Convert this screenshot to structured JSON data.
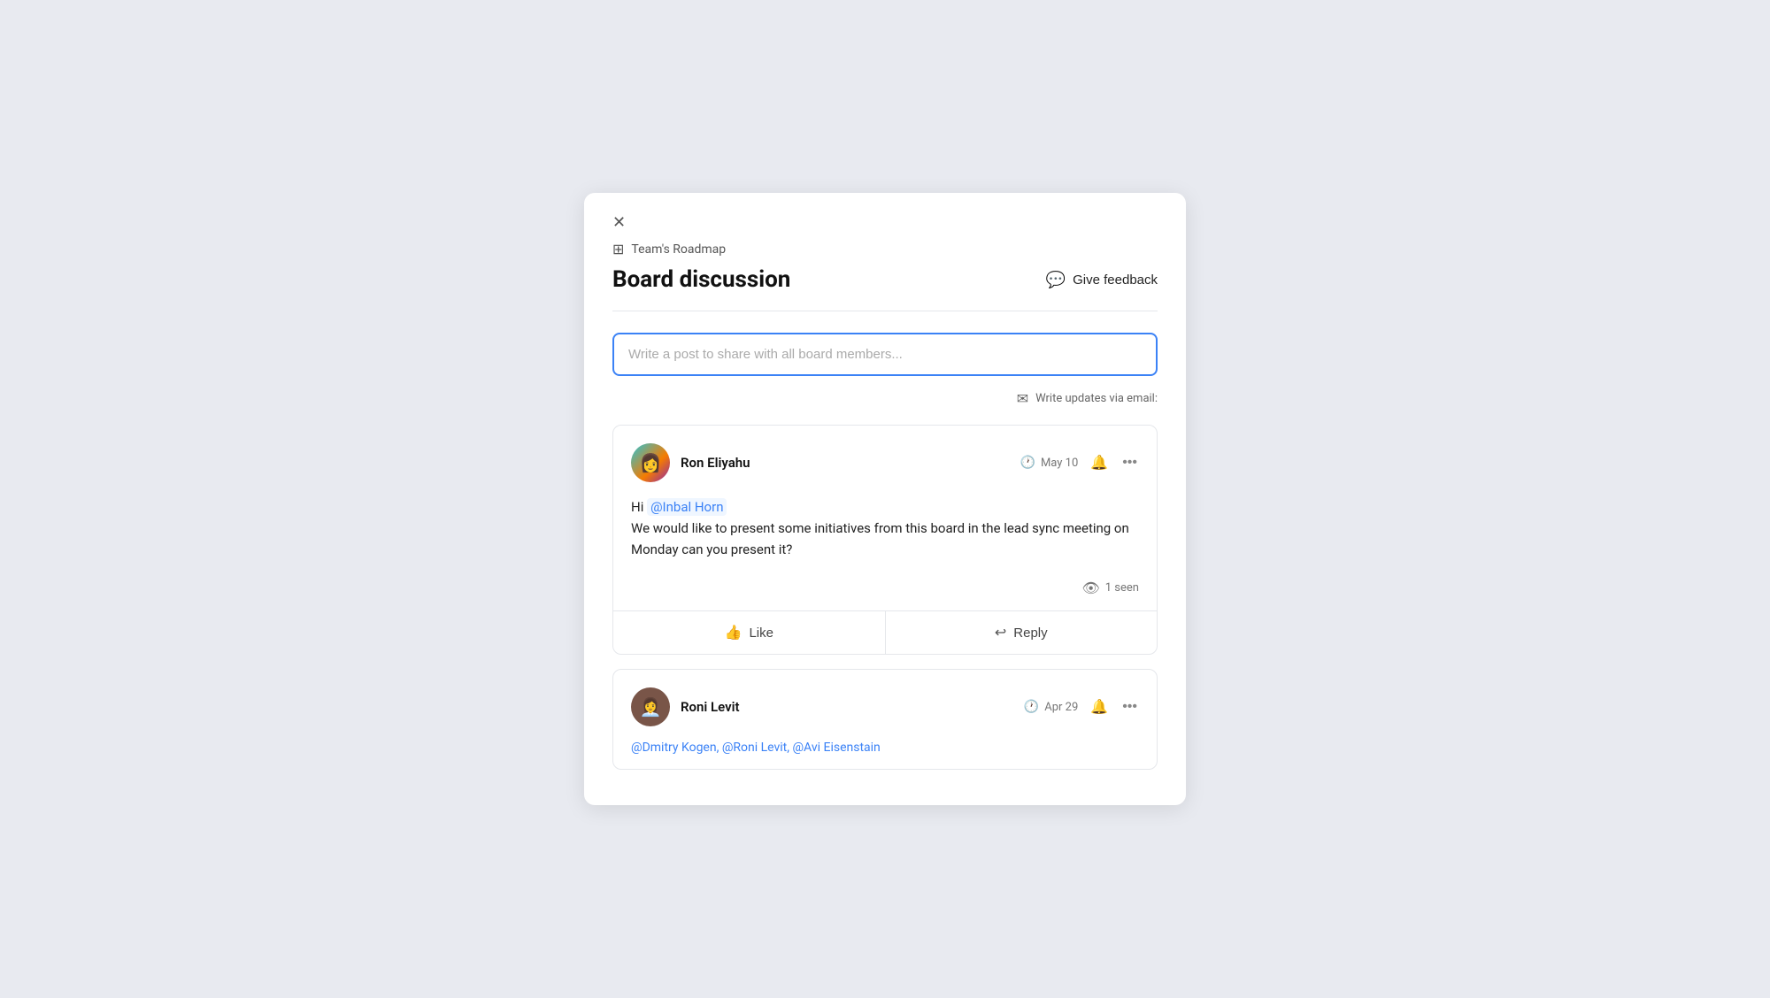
{
  "modal": {
    "close_label": "×",
    "breadcrumb": {
      "icon": "⊞",
      "text": "Team's Roadmap"
    },
    "title": "Board discussion",
    "give_feedback_label": "Give feedback",
    "post_input_placeholder": "Write a post to share with all board members...",
    "email_update_text": "Write updates via email:",
    "posts": [
      {
        "id": "post-1",
        "author_name": "Ron Eliyahu",
        "avatar_emoji": "👩",
        "date": "May 10",
        "message_line1": "Hi ",
        "mention": "@Inbal Horn",
        "message_line2": "We would like to present some initiatives from this board in the lead sync meeting on Monday can you present it?",
        "seen_count": "1 seen",
        "like_label": "Like",
        "reply_label": "Reply"
      },
      {
        "id": "post-2",
        "author_name": "Roni Levit",
        "avatar_emoji": "👩‍💼",
        "date": "Apr 29",
        "mentions_line": "@Dmitry Kogen, @Roni Levit, @Avi Eisenstain"
      }
    ]
  }
}
